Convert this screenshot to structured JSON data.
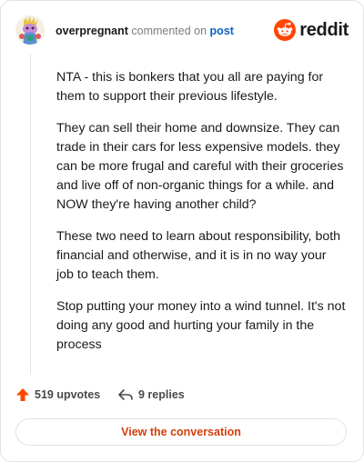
{
  "header": {
    "username": "overpregnant",
    "action": "commented on",
    "link_text": "post",
    "brand": "reddit"
  },
  "comment": {
    "paragraphs": [
      "NTA - this is bonkers that you all are paying for them to support their previous lifestyle.",
      "They can sell their home and downsize. They can trade in their cars for less expensive models. they can be more frugal and careful with their groceries and live off of non-organic things for a while. and NOW they're having another child?",
      "These two need to learn about responsibility, both financial and otherwise, and it is in no way your job to teach them.",
      "Stop putting your money into a wind tunnel. It's not doing any good and hurting your family in the process"
    ]
  },
  "footer": {
    "upvotes": "519 upvotes",
    "replies": "9 replies",
    "view_button": "View the conversation"
  },
  "colors": {
    "brand_orange": "#ff4500",
    "upvote": "#ff4500",
    "link_blue": "#0b62c4",
    "button_text": "#d43e0a"
  },
  "icons": {
    "avatar": "snoo-avatar",
    "logo": "reddit-alien-icon",
    "upvote": "upvote-arrow-icon",
    "reply": "reply-arrow-icon"
  }
}
